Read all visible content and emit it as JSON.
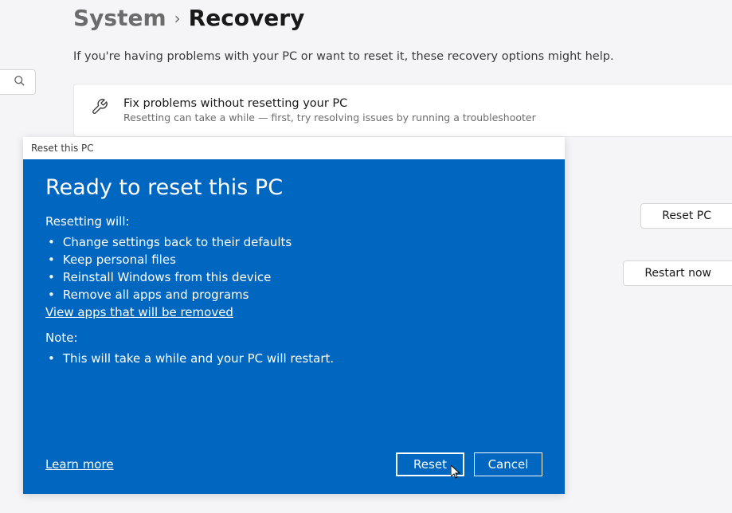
{
  "breadcrumb": {
    "parent": "System",
    "separator": "›",
    "current": "Recovery"
  },
  "intro": "If you're having problems with your PC or want to reset it, these recovery options might help.",
  "fix_card": {
    "title": "Fix problems without resetting your PC",
    "subtitle": "Resetting can take a while — first, try resolving issues by running a troubleshooter"
  },
  "buttons": {
    "reset_pc": "Reset PC",
    "restart_now": "Restart now"
  },
  "modal": {
    "titlebar": "Reset this PC",
    "heading": "Ready to reset this PC",
    "resetting_label": "Resetting will:",
    "reset_items": [
      "Change settings back to their defaults",
      "Keep personal files",
      "Reinstall Windows from this device",
      "Remove all apps and programs"
    ],
    "view_apps_link": "View apps that will be removed",
    "note_label": "Note:",
    "note_items": [
      "This will take a while and your PC will restart."
    ],
    "learn_more": "Learn more",
    "reset_btn": "Reset",
    "cancel_btn": "Cancel"
  },
  "colors": {
    "accent": "#0067c0",
    "page_bg": "#f5f5f7"
  }
}
